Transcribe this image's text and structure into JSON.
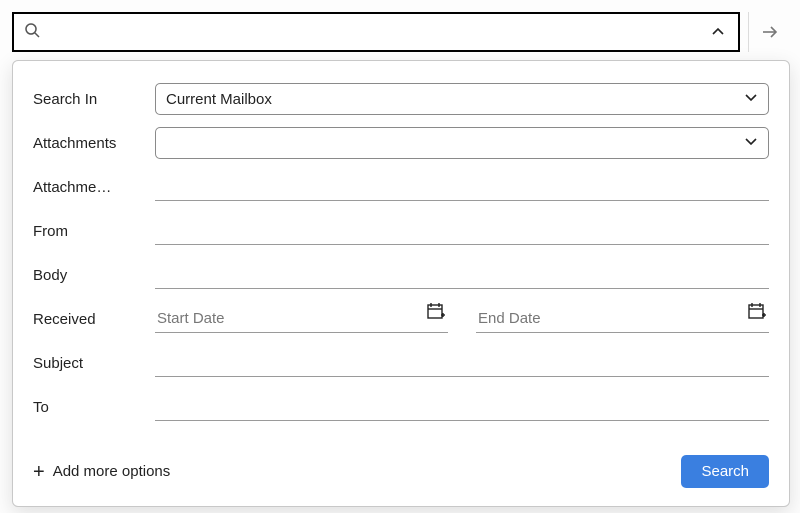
{
  "search": {
    "value": "",
    "placeholder": ""
  },
  "fields": {
    "searchIn": {
      "label": "Search In",
      "selected": "Current Mailbox"
    },
    "attachments": {
      "label": "Attachments",
      "selected": ""
    },
    "attachmentContains": {
      "label": "Attachme…",
      "value": ""
    },
    "from": {
      "label": "From",
      "value": ""
    },
    "body": {
      "label": "Body",
      "value": ""
    },
    "received": {
      "label": "Received",
      "start": {
        "placeholder": "Start Date",
        "value": ""
      },
      "end": {
        "placeholder": "End Date",
        "value": ""
      }
    },
    "subject": {
      "label": "Subject",
      "value": ""
    },
    "to": {
      "label": "To",
      "value": ""
    }
  },
  "footer": {
    "addMore": "Add more options",
    "searchBtn": "Search"
  }
}
